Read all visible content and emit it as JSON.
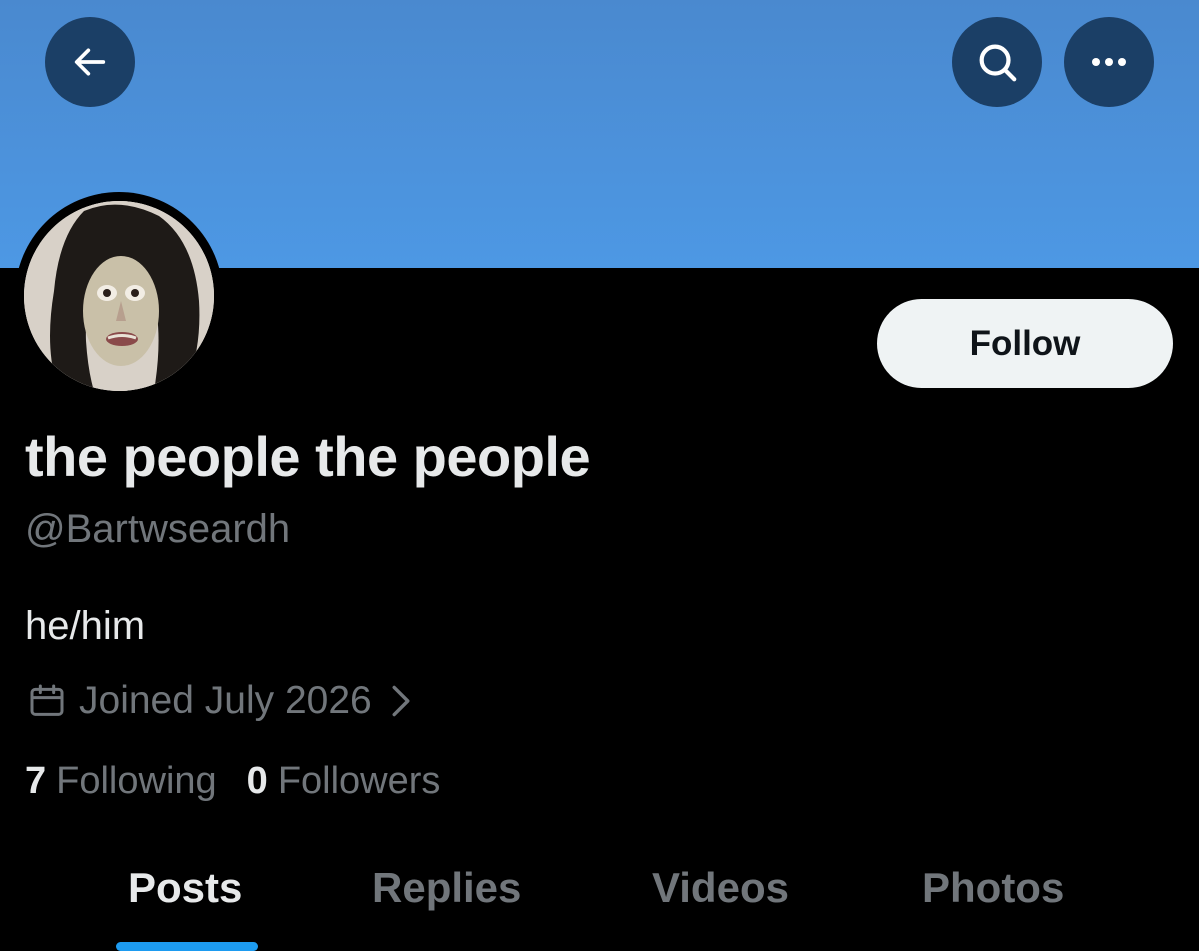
{
  "header": {
    "back_icon": "arrow-left-icon",
    "search_icon": "search-icon",
    "more_icon": "more-horizontal-icon",
    "banner_color": "#4a8fd8"
  },
  "profile": {
    "avatar_icon": "profile-avatar",
    "display_name": "the people the people",
    "handle": "@Bartwseardh",
    "bio": "he/him",
    "joined": "Joined July 2026",
    "calendar_icon": "calendar-icon",
    "chevron_icon": "chevron-right-icon",
    "follow_label": "Follow"
  },
  "stats": {
    "following_count": "7",
    "following_label": "Following",
    "followers_count": "0",
    "followers_label": "Followers"
  },
  "tabs": [
    {
      "label": "Posts",
      "active": true
    },
    {
      "label": "Replies",
      "active": false
    },
    {
      "label": "Videos",
      "active": false
    },
    {
      "label": "Photos",
      "active": false
    }
  ],
  "colors": {
    "accent": "#1d9bf0",
    "background": "#000000",
    "header_button": "#1b3f66"
  }
}
